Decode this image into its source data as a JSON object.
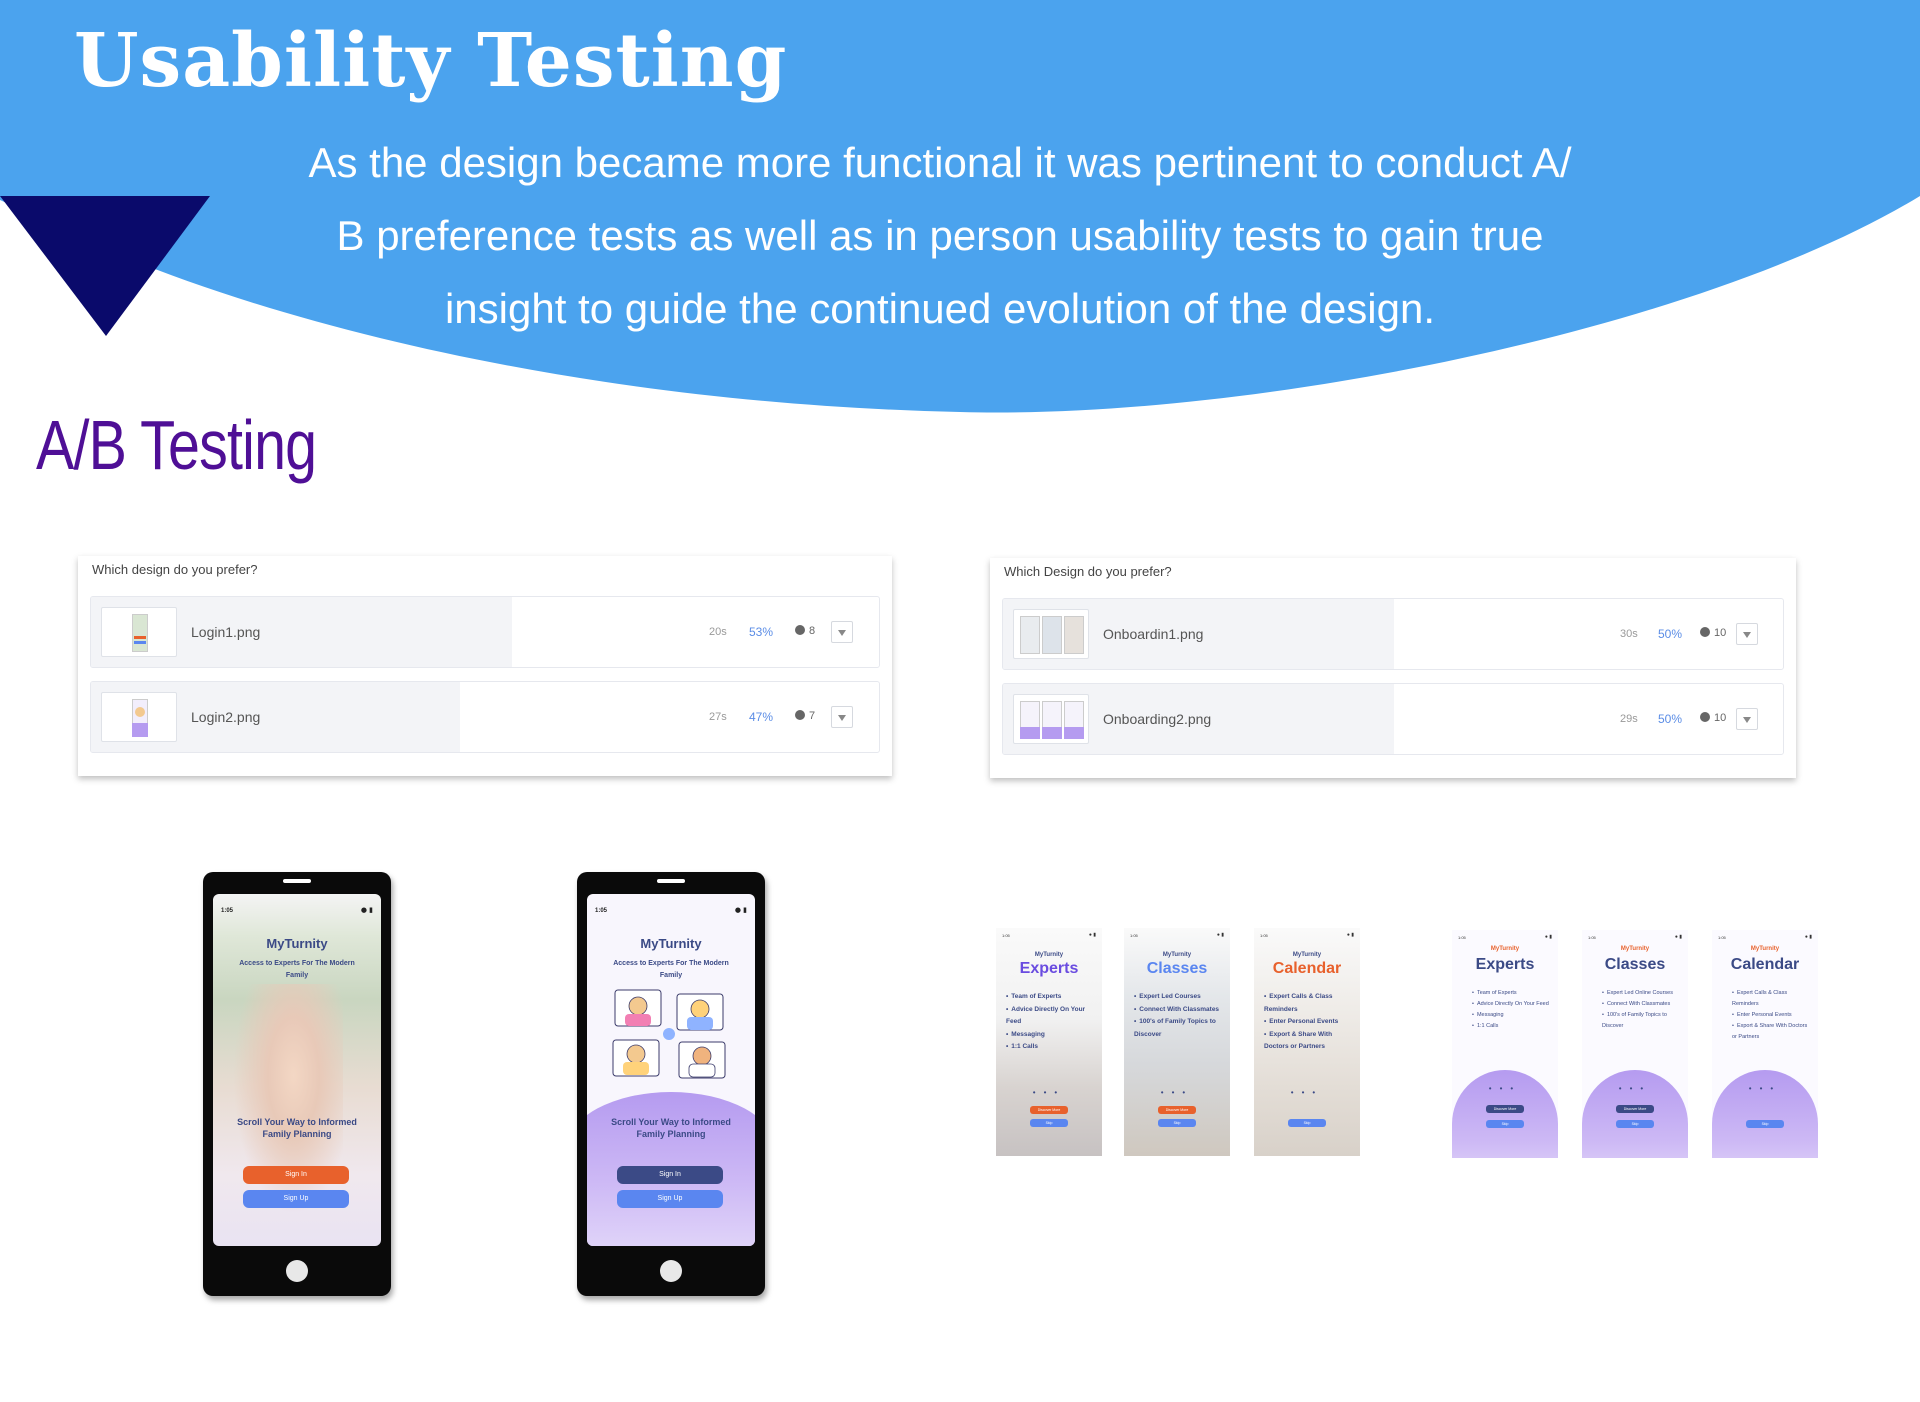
{
  "header": {
    "title": "Usability  Testing",
    "intro_lines": [
      "As the design became more functional it was pertinent to conduct A/",
      "B preference tests as well as in person usability tests to gain true",
      "insight to guide the continued evolution of the design."
    ]
  },
  "section_title": "A/B Testing",
  "colors": {
    "hero_blue": "#4ba3ee",
    "triangle_navy": "#0a0a6b",
    "section_purple": "#4f0f96",
    "percent_blue": "#5b8de6",
    "sign_in_orange": "#e8612c",
    "sign_up_blue": "#5a86f0",
    "navy_button": "#3b4a86",
    "lavender": "#b59bf0"
  },
  "survey_login": {
    "question": "Which design do you prefer?",
    "options": [
      {
        "file": "Login1.png",
        "time": "20s",
        "percent": "53%",
        "share": 0.53,
        "voters": "8"
      },
      {
        "file": "Login2.png",
        "time": "27s",
        "percent": "47%",
        "share": 0.47,
        "voters": "7"
      }
    ]
  },
  "survey_onboarding": {
    "question": "Which Design do you prefer?",
    "options": [
      {
        "file": "Onboardin1.png",
        "time": "30s",
        "percent": "50%",
        "share": 0.5,
        "voters": "10"
      },
      {
        "file": "Onboarding2.png",
        "time": "29s",
        "percent": "50%",
        "share": 0.5,
        "voters": "10"
      }
    ]
  },
  "phone_common": {
    "status_time": "1:05",
    "app_name": "MyTurnity",
    "tagline": "Access to Experts For The Modern Family",
    "scroll_text": "Scroll Your Way to Informed Family Planning",
    "sign_in": "Sign In",
    "sign_up": "Sign Up"
  },
  "onboarding_common": {
    "brand": "MyTurnity",
    "status_time": "1:05",
    "discover_btn": "Discover More",
    "skip_btn": "Skip"
  },
  "onboarding1": [
    {
      "title": "Experts",
      "items": [
        "Team of Experts",
        "Advice Directly On Your Feed",
        "Messaging",
        "1:1 Calls"
      ]
    },
    {
      "title": "Classes",
      "items": [
        "Expert Led Courses",
        "Connect With Classmates",
        "100's of Family Topics to Discover"
      ]
    },
    {
      "title": "Calendar",
      "items": [
        "Expert Calls & Class Reminders",
        "Enter Personal Events",
        "Export & Share With Doctors or Partners"
      ]
    }
  ],
  "onboarding2": [
    {
      "title": "Experts",
      "items": [
        "Team of Experts",
        "Advice Directly On Your Feed",
        "Messaging",
        "1:1 Calls"
      ]
    },
    {
      "title": "Classes",
      "items": [
        "Expert Led Online Courses",
        "Connect With Classmates",
        "100's of Family Topics to Discover"
      ]
    },
    {
      "title": "Calendar",
      "items": [
        "Expert Calls & Class Reminders",
        "Enter Personal Events",
        "Export & Share With Doctors or Partners"
      ]
    }
  ]
}
